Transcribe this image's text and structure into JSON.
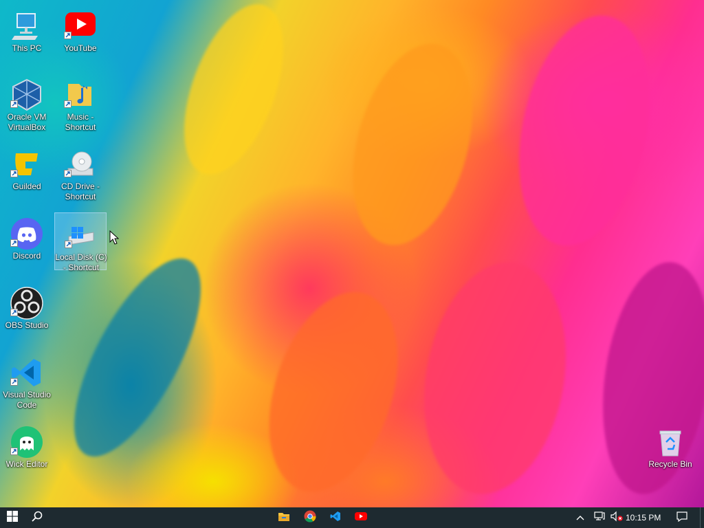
{
  "desktop": {
    "icons": [
      {
        "label": "This PC"
      },
      {
        "label": "YouTube"
      },
      {
        "label": "Oracle VM VirtualBox"
      },
      {
        "label": "Music - Shortcut"
      },
      {
        "label": "Guilded"
      },
      {
        "label": "CD Drive - Shortcut"
      },
      {
        "label": "Discord"
      },
      {
        "label": "Local Disk (C) - Shortcut"
      },
      {
        "label": "OBS Studio"
      },
      {
        "label": "Visual Studio Code"
      },
      {
        "label": "Wick Editor"
      },
      {
        "label": "Recycle Bin"
      }
    ]
  },
  "taskbar": {
    "start_icon": "windows-logo-icon",
    "search_icon": "search-icon",
    "pinned_apps": [
      "file-explorer-icon",
      "chrome-icon",
      "visual-studio-code-icon",
      "youtube-icon"
    ],
    "tray": {
      "clock": "10:15 PM"
    }
  },
  "colors": {
    "taskbar_bg": "#1e2a30",
    "selection": "#c8e1ff"
  }
}
